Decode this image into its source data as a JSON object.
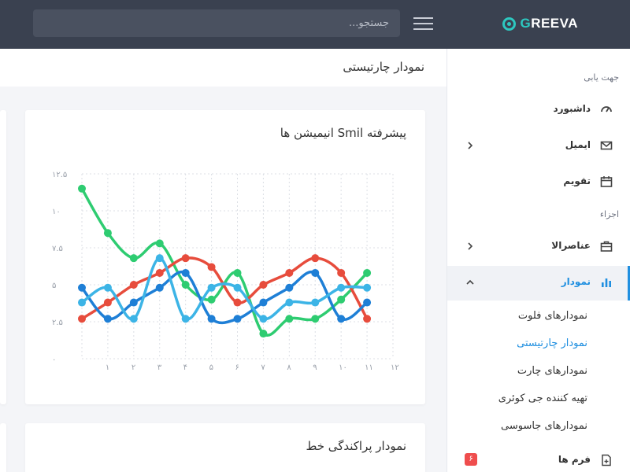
{
  "topbar": {
    "logo_rest": "REEVA",
    "logo_g": "G",
    "search_placeholder": "جستجو..."
  },
  "page": {
    "title": "نمودار چارتیستی"
  },
  "sidebar": {
    "section_nav": "جهت یابی",
    "section_parts": "اجزاء",
    "items": [
      {
        "label": "داشبورد",
        "icon": "dashboard-gauge-icon"
      },
      {
        "label": "ایمیل",
        "icon": "mail-icon"
      },
      {
        "label": "تقویم",
        "icon": "calendar-icon"
      },
      {
        "label": "عناصرالا",
        "icon": "briefcase-icon"
      },
      {
        "label": "نمودار",
        "icon": "bar-chart-icon"
      },
      {
        "label": "فرم ها",
        "icon": "form-document-icon",
        "badge": "۶"
      }
    ],
    "chart_submenu": [
      "نمودارهای فلوت",
      "نمودار چارتیستی",
      "نمودارهای چارت",
      "تهیه کننده جی کوئری",
      "نمودارهای جاسوسی"
    ]
  },
  "cards": {
    "chart_title": "پیشرفته Smil انیمیشن ها",
    "scatter_title": "نمودار پراکندگی خط"
  },
  "colors": {
    "topbar": "#3a4150",
    "accent": "#1f8fe0",
    "brand": "#2dc8c0",
    "badge": "#ef4d4d"
  },
  "chart_data": {
    "type": "line",
    "x": [
      1,
      2,
      3,
      4,
      5,
      6,
      7,
      8,
      9,
      10,
      11,
      12
    ],
    "xlim": [
      0,
      12
    ],
    "ylim": [
      0,
      12.5
    ],
    "x_tick_labels": [
      "۱",
      "۲",
      "۳",
      "۴",
      "۵",
      "۶",
      "۷",
      "۸",
      "۹",
      "۱۰",
      "۱۱",
      "۱۲"
    ],
    "y_ticks": [
      0,
      2.5,
      5,
      7.5,
      10,
      12.5
    ],
    "y_tick_labels": [
      "۰",
      "۲.۵",
      "۵",
      "۷.۵",
      "۱۰",
      "۱۲.۵"
    ],
    "grid": true,
    "smooth": true,
    "series": [
      {
        "color": "#2ecc71",
        "x": [
          0,
          1,
          2,
          3,
          4,
          5,
          6,
          7,
          8,
          9,
          10,
          11
        ],
        "values": [
          11.5,
          8.5,
          6.8,
          7.8,
          5,
          4,
          5.8,
          1.7,
          2.7,
          2.7,
          4,
          5.8
        ]
      },
      {
        "color": "#e74c3c",
        "x": [
          0,
          1,
          2,
          3,
          4,
          5,
          6,
          7,
          8,
          9,
          10,
          11
        ],
        "values": [
          2.7,
          3.8,
          5,
          5.8,
          6.8,
          6.2,
          3.8,
          5,
          5.8,
          6.8,
          5.8,
          2.7
        ]
      },
      {
        "color": "#1e7fd6",
        "x": [
          0,
          1,
          2,
          3,
          4,
          5,
          6,
          7,
          8,
          9,
          10,
          11
        ],
        "values": [
          4.8,
          2.7,
          3.8,
          4.8,
          5.8,
          2.7,
          2.7,
          3.8,
          4.8,
          5.8,
          2.7,
          3.8
        ]
      },
      {
        "color": "#3cb4e6",
        "x": [
          0,
          1,
          2,
          3,
          4,
          5,
          6,
          7,
          8,
          9,
          10,
          11
        ],
        "values": [
          3.8,
          4.8,
          2.7,
          6.8,
          2.7,
          4.8,
          4.8,
          2.7,
          3.8,
          3.8,
          4.8,
          4.8
        ]
      }
    ]
  }
}
